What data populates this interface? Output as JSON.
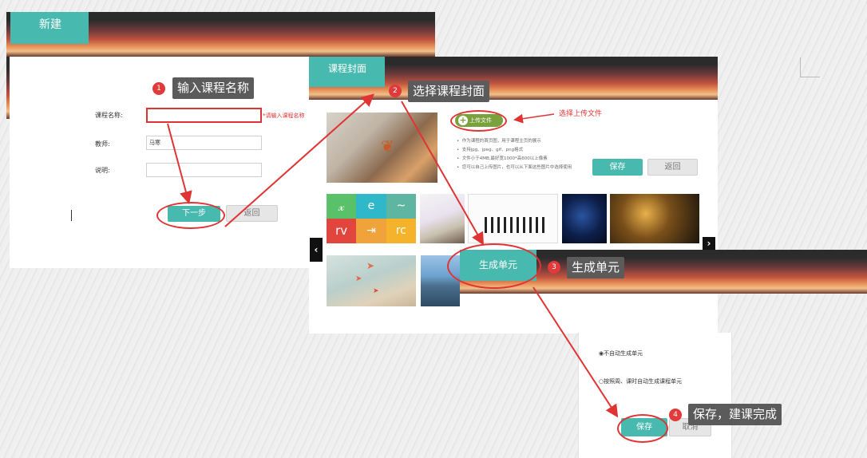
{
  "step1": {
    "header": "新建",
    "fields": [
      {
        "label": "课程名称:",
        "value": ""
      },
      {
        "label": "教师:",
        "value": "马寒"
      },
      {
        "label": "说明:",
        "value": ""
      }
    ],
    "required_hint": "*请输入课程名称",
    "next_button": "下一步",
    "back_button": "返回"
  },
  "step2": {
    "header": "课程封面",
    "upload_button": "上传文件",
    "upload_hint": "选择上传文件",
    "notes": [
      "作为课程的首页图，用于课程主页的展示",
      "支持jpg、jpeg、gif、png格式",
      "文件小于4MB,最好宽1000*高600以上像素",
      "您可以自己上传图片，也可以从下面这些图片中选择使用"
    ],
    "save_button": "保存",
    "back_button": "返回"
  },
  "step3": {
    "header": "生成单元",
    "options": [
      "不自动生成单元",
      "按照周、课时自动生成课程单元"
    ],
    "selected_option": 0,
    "save_button": "保存",
    "cancel_button": "取消"
  },
  "callouts": [
    {
      "num": "1",
      "text": "输入课程名称"
    },
    {
      "num": "2",
      "text": "选择课程封面"
    },
    {
      "num": "3",
      "text": "生成单元"
    },
    {
      "num": "4",
      "text": "保存，建课完成"
    }
  ],
  "colors": {
    "accent": "#48b9ae",
    "annotation": "#e03434",
    "callout_bg": "#5b5b5b"
  }
}
